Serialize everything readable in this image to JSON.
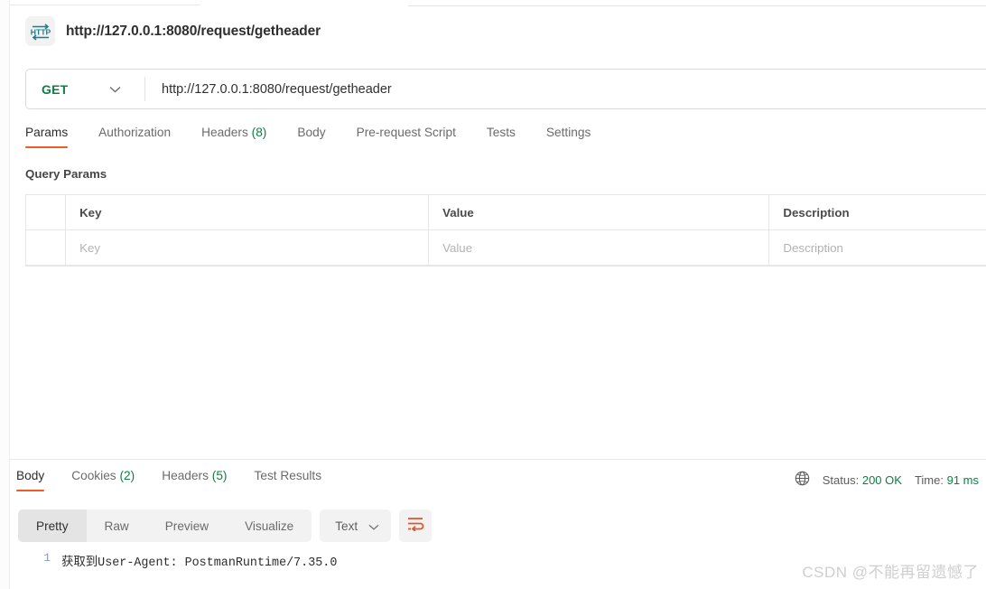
{
  "request": {
    "icon": "http-protocol-icon",
    "name": "http://127.0.0.1:8080/request/getheader",
    "method": "GET",
    "url": "http://127.0.0.1:8080/request/getheader",
    "tabs": [
      {
        "label": "Params",
        "count": "",
        "active": true
      },
      {
        "label": "Authorization",
        "count": "",
        "active": false
      },
      {
        "label": "Headers",
        "count": "(8)",
        "active": false
      },
      {
        "label": "Body",
        "count": "",
        "active": false
      },
      {
        "label": "Pre-request Script",
        "count": "",
        "active": false
      },
      {
        "label": "Tests",
        "count": "",
        "active": false
      },
      {
        "label": "Settings",
        "count": "",
        "active": false
      }
    ]
  },
  "query_params": {
    "title": "Query Params",
    "headers": {
      "key": "Key",
      "value": "Value",
      "description": "Description"
    },
    "rows": [
      {
        "key": "Key",
        "value": "Value",
        "description": "Description"
      }
    ]
  },
  "response": {
    "tabs": [
      {
        "label": "Body",
        "count": "",
        "active": true
      },
      {
        "label": "Cookies",
        "count": "(2)",
        "active": false
      },
      {
        "label": "Headers",
        "count": "(5)",
        "active": false
      },
      {
        "label": "Test Results",
        "count": "",
        "active": false
      }
    ],
    "status": {
      "globe_icon": "globe-icon",
      "status_label": "Status:",
      "status_value": "200 OK",
      "time_label": "Time:",
      "time_value": "91 ms"
    },
    "format_bar": {
      "views": [
        {
          "label": "Pretty",
          "active": true
        },
        {
          "label": "Raw",
          "active": false
        },
        {
          "label": "Preview",
          "active": false
        },
        {
          "label": "Visualize",
          "active": false
        }
      ],
      "language": "Text",
      "wrap_icon": "word-wrap-icon"
    },
    "body": {
      "lines": [
        {
          "number": "1",
          "text": "获取到User-Agent: PostmanRuntime/7.35.0"
        }
      ]
    }
  },
  "watermark": "CSDN @不能再留遗憾了",
  "colors": {
    "accent": "#ef5b25",
    "success": "#0b8043",
    "http_icon": "#1a7f8e"
  }
}
